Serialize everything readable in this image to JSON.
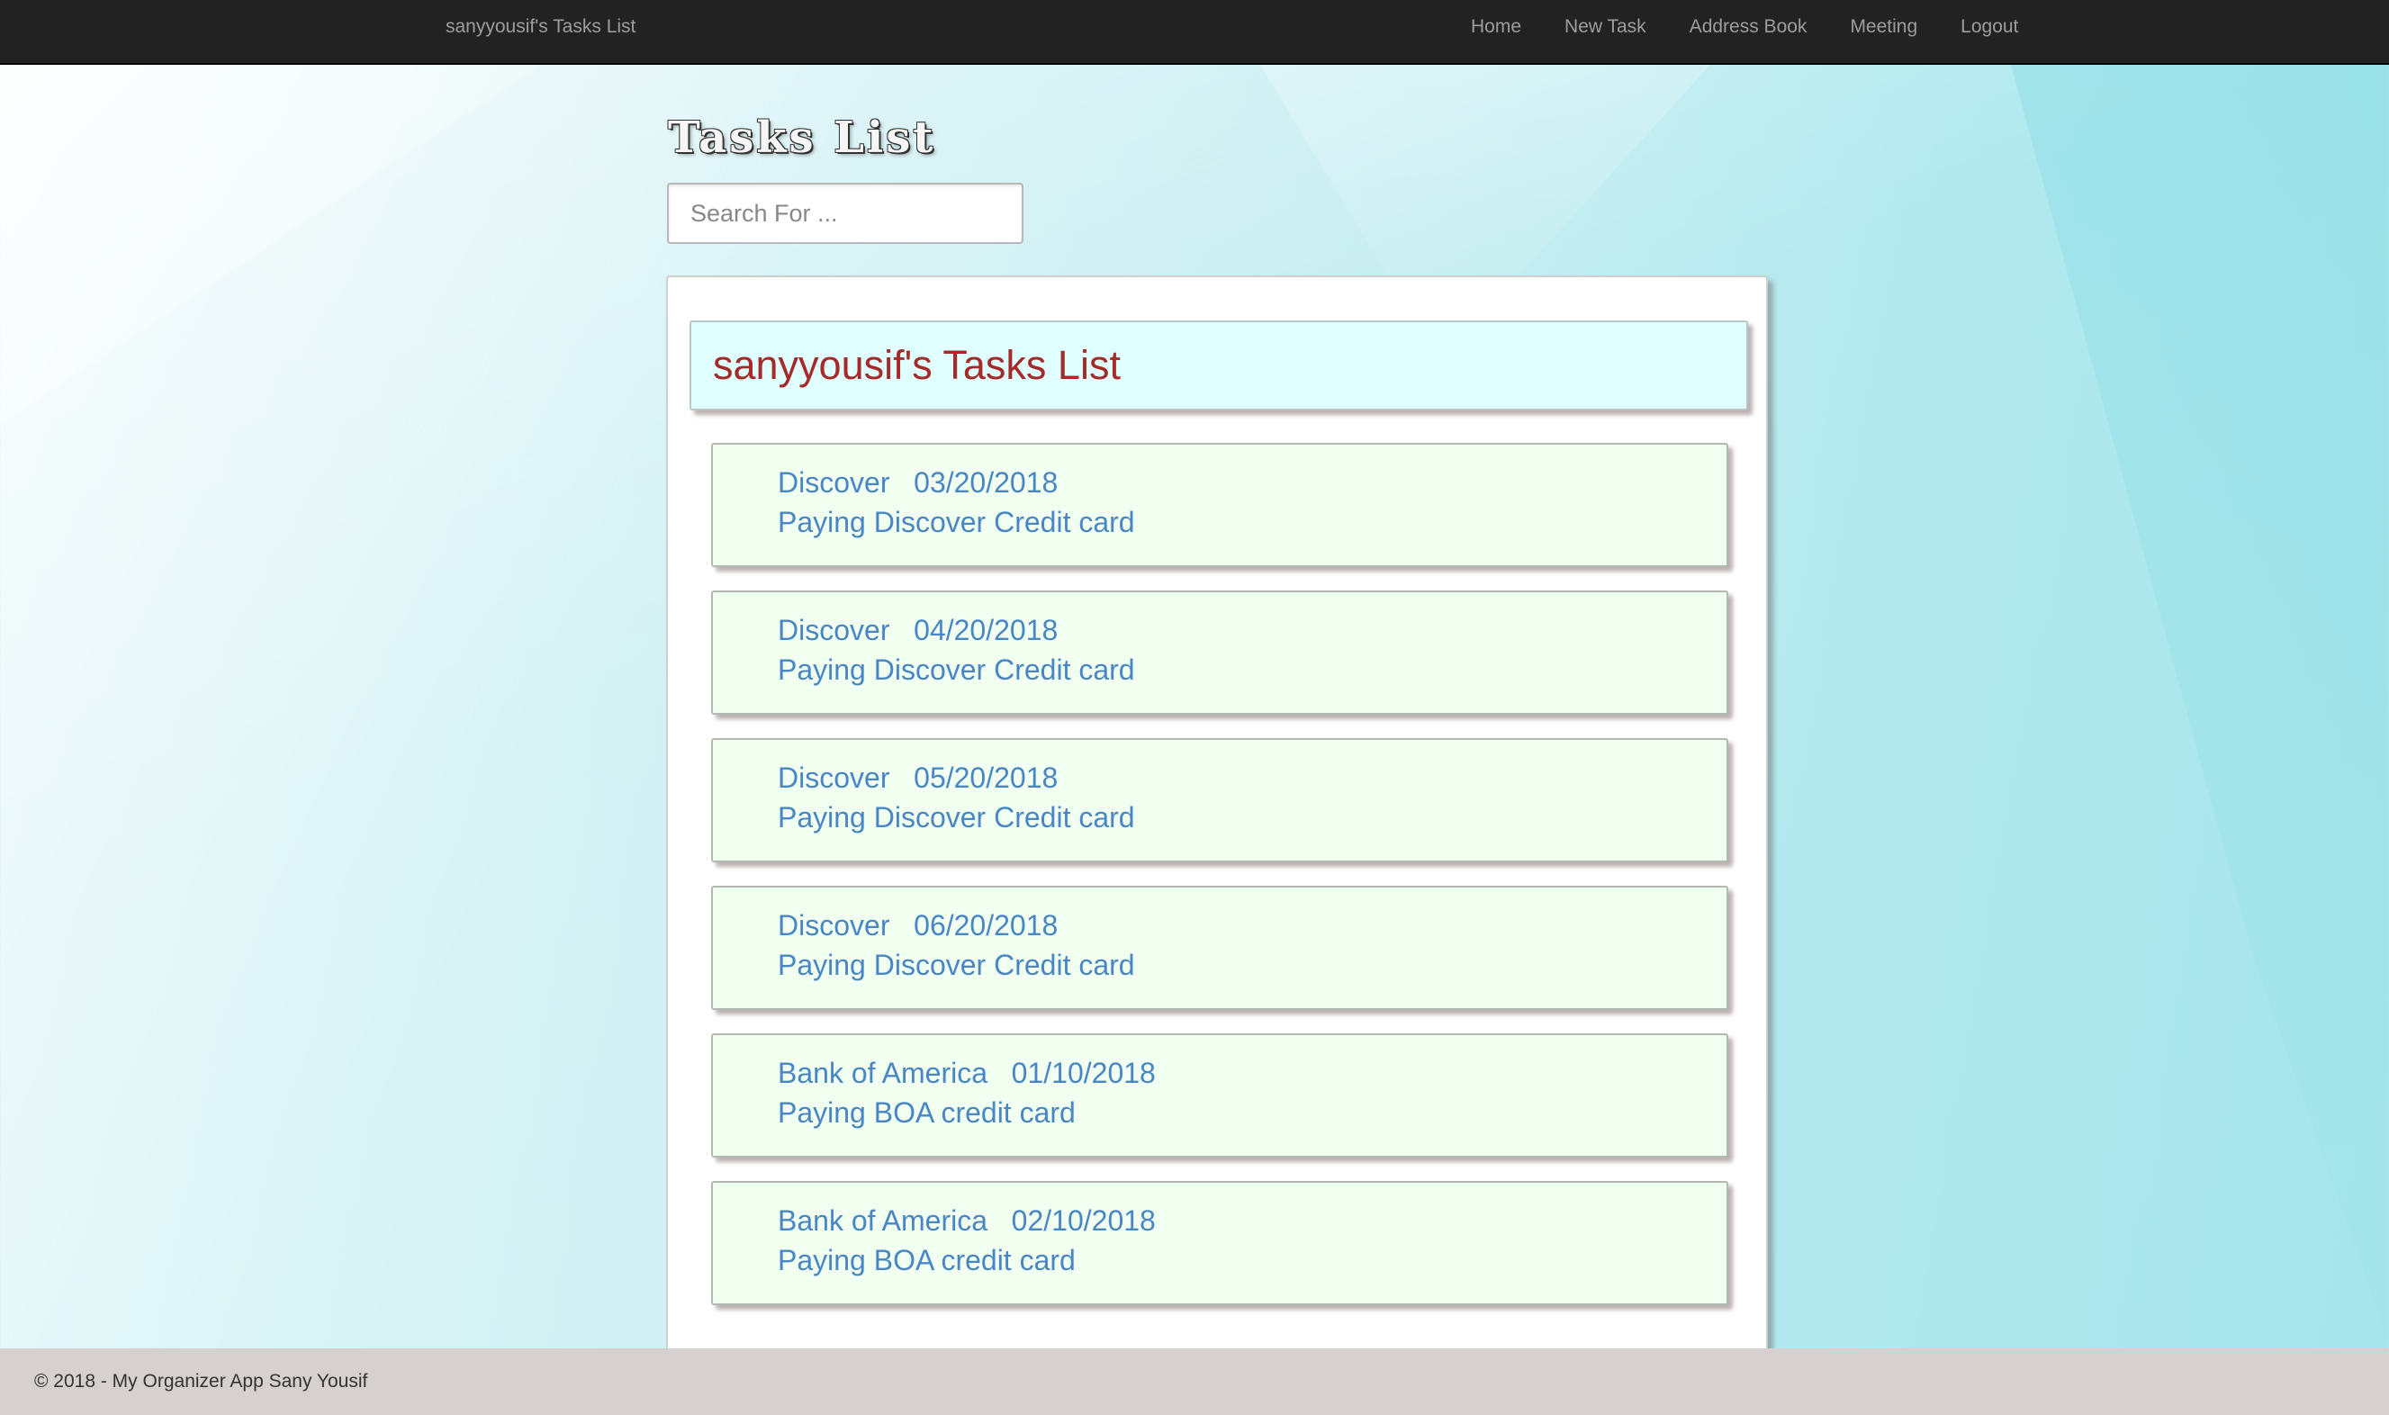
{
  "navbar": {
    "brand": "sanyyousif's Tasks List",
    "links": [
      "Home",
      "New Task",
      "Address Book",
      "Meeting",
      "Logout"
    ],
    "background": "#222222"
  },
  "page": {
    "title": "Tasks List",
    "search_placeholder": "Search For ..."
  },
  "panel": {
    "header": "sanyyousif's Tasks List",
    "header_color": "#a52a2a",
    "header_background": "#e0ffff",
    "task_background": "#f0fff0",
    "task_text_color": "#4a86c4"
  },
  "tasks": [
    {
      "name": "Discover",
      "date": "03/20/2018",
      "description": "Paying Discover Credit card"
    },
    {
      "name": "Discover",
      "date": "04/20/2018",
      "description": "Paying Discover Credit card"
    },
    {
      "name": "Discover",
      "date": "05/20/2018",
      "description": "Paying Discover Credit card"
    },
    {
      "name": "Discover",
      "date": "06/20/2018",
      "description": "Paying Discover Credit card"
    },
    {
      "name": "Bank of America",
      "date": "01/10/2018",
      "description": "Paying BOA credit card"
    },
    {
      "name": "Bank of America",
      "date": "02/10/2018",
      "description": "Paying BOA credit card"
    }
  ],
  "footer": {
    "text": "© 2018 - My Organizer App Sany Yousif"
  }
}
